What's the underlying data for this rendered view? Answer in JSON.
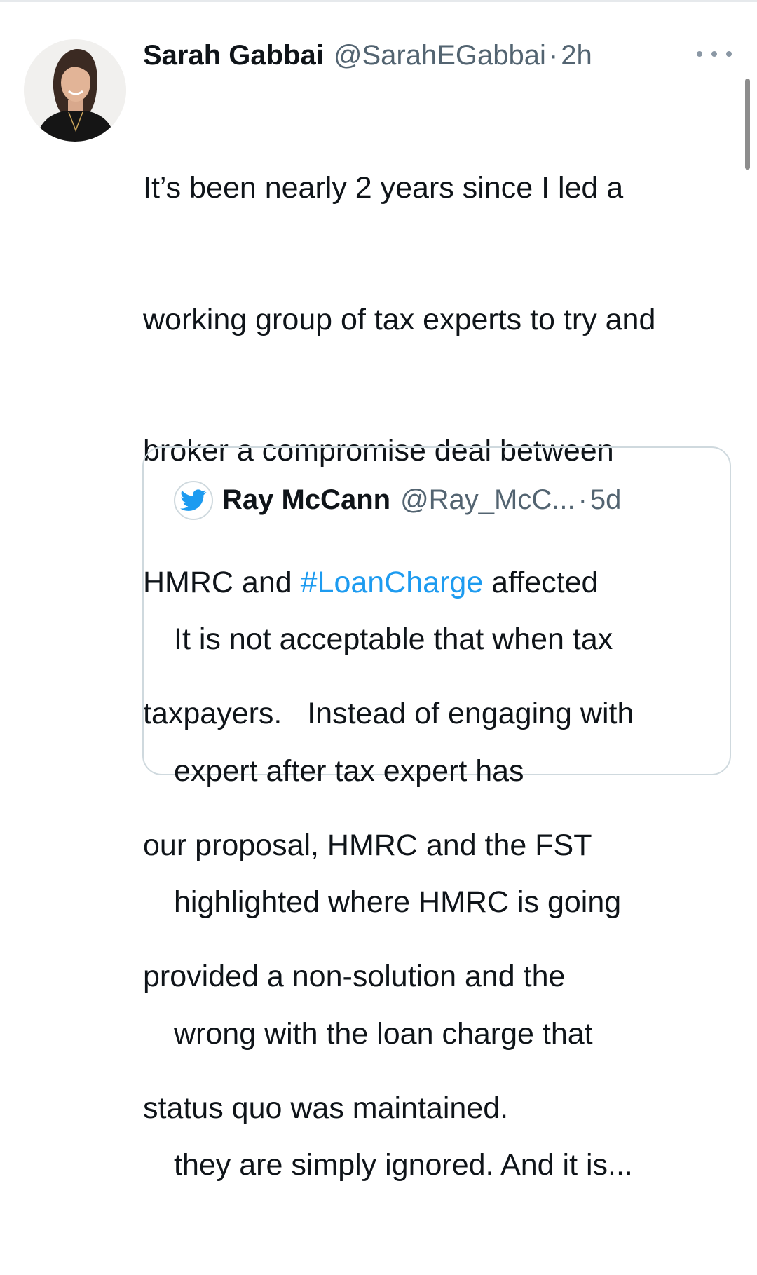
{
  "tweet": {
    "display_name": "Sarah Gabbai",
    "handle": "@SarahEGabbai",
    "separator": "·",
    "time": "2h",
    "more_icon": "more-horizontal-icon",
    "text_lines": [
      {
        "text": "It’s been nearly 2 years since I led a"
      },
      {
        "text": "working group of tax experts to try and"
      },
      {
        "text": "broker a compromise deal between"
      },
      {
        "before": "HMRC and ",
        "hashtag": "#LoanCharge",
        "after": " affected"
      },
      {
        "text": "taxpayers.   Instead of engaging with"
      },
      {
        "text": "our proposal, HMRC and the FST"
      },
      {
        "text": "provided a non-solution and the"
      },
      {
        "text": "status quo was maintained."
      }
    ]
  },
  "quote": {
    "avatar_icon": "twitter-bird-icon",
    "display_name": "Ray McCann",
    "handle": "@Ray_McC...",
    "separator": "·",
    "time": "5d",
    "text_lines": [
      "It is not acceptable that when tax",
      "expert after tax expert has",
      "highlighted where HMRC is going",
      "wrong with the loan charge that",
      "they are simply ignored. And it is..."
    ]
  },
  "colors": {
    "text": "#0f1419",
    "secondary": "#536471",
    "link": "#1d9bf0",
    "border": "#cfd9de"
  }
}
